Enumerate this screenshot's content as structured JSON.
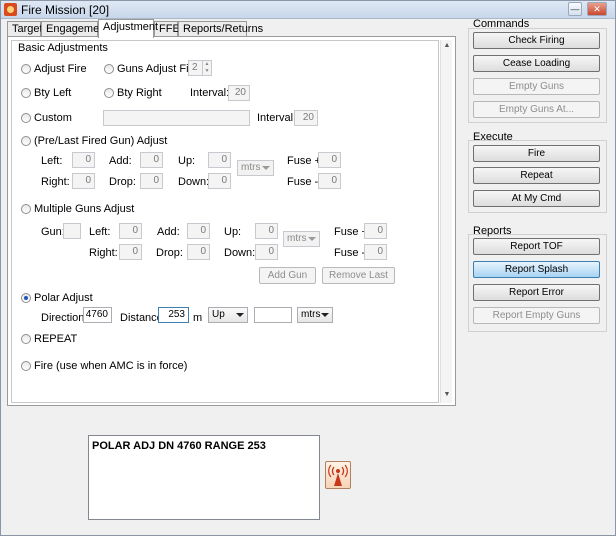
{
  "window": {
    "title": "Fire Mission [20]"
  },
  "tabs": [
    "Target",
    "Engagement",
    "Adjustment",
    "FFE",
    "Reports/Returns"
  ],
  "active_tab": "Adjustment",
  "basic": {
    "group_label": "Basic Adjustments",
    "adjust_fire": "Adjust Fire",
    "guns_adjust_fire": "Guns Adjust Fire",
    "guns_count": "2",
    "bty_left": "Bty Left",
    "bty_right": "Bty Right",
    "interval_label": "Interval:",
    "interval_value": "20",
    "custom": "Custom",
    "custom_value": "",
    "custom_interval_label": "Interval:",
    "custom_interval_value": "20",
    "pre_last": "(Pre/Last Fired Gun) Adjust",
    "left_label": "Left:",
    "left_value": "0",
    "add_label": "Add:",
    "add_value": "0",
    "up_label": "Up:",
    "up_value": "0",
    "unit": "mtrs",
    "fuse_plus_label": "Fuse +",
    "fuse_plus_value": "0",
    "right_label": "Right:",
    "right_value": "0",
    "drop_label": "Drop:",
    "drop_value": "0",
    "down_label": "Down:",
    "down_value": "0",
    "fuse_minus_label": "Fuse -",
    "fuse_minus_value": "0"
  },
  "multi": {
    "label": "Multiple Guns Adjust",
    "gun_label": "Gun:",
    "gun_value": "",
    "left_label": "Left:",
    "left_value": "0",
    "add_label": "Add:",
    "add_value": "0",
    "up_label": "Up:",
    "up_value": "0",
    "unit": "mtrs",
    "fuse_plus_label": "Fuse +",
    "fuse_plus_value": "0",
    "right_label": "Right:",
    "right_value": "0",
    "drop_label": "Drop:",
    "drop_value": "0",
    "down_label": "Down:",
    "down_value": "0",
    "fuse_minus_label": "Fuse -",
    "fuse_minus_value": "0",
    "add_gun": "Add Gun",
    "remove_last": "Remove Last"
  },
  "polar": {
    "label": "Polar Adjust",
    "direction_label": "Direction:",
    "direction_value": "4760",
    "distance_label": "Distance:",
    "distance_value": "253",
    "distance_unit": "m",
    "updown_value": "Up",
    "extra_value": "",
    "unit_value": "mtrs"
  },
  "repeat": "REPEAT",
  "fire_amc": "Fire (use when AMC is in force)",
  "message": "POLAR ADJ DN 4760 RANGE 253",
  "commands": {
    "title": "Commands",
    "check_firing": "Check Firing",
    "cease_loading": "Cease Loading",
    "empty_guns": "Empty Guns",
    "empty_guns_at": "Empty Guns At..."
  },
  "execute": {
    "title": "Execute",
    "fire": "Fire",
    "repeat": "Repeat",
    "at_my_cmd": "At My Cmd"
  },
  "reports": {
    "title": "Reports",
    "report_tof": "Report TOF",
    "report_splash": "Report Splash",
    "report_error": "Report Error",
    "report_empty_guns": "Report Empty Guns"
  }
}
